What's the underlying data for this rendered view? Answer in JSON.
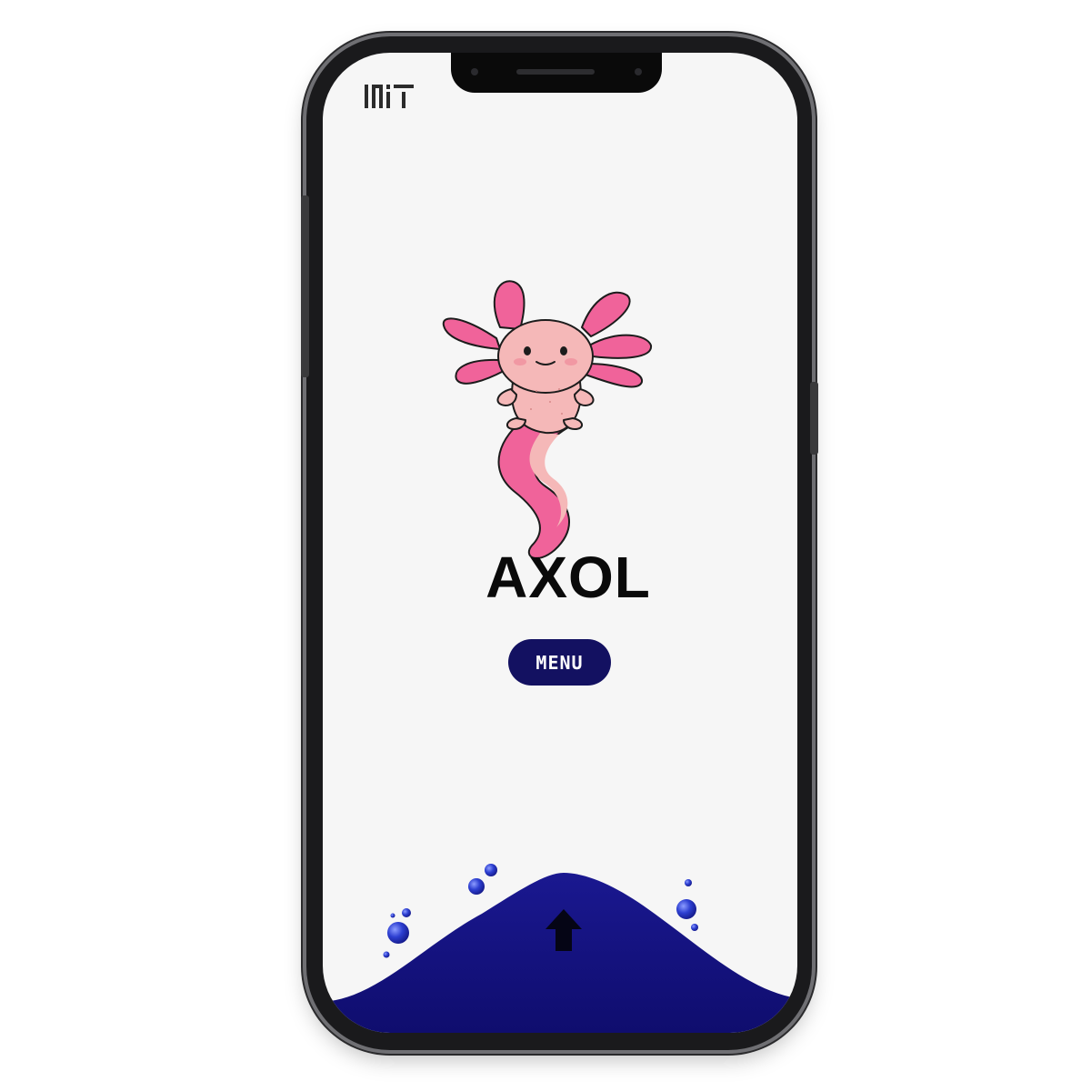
{
  "app": {
    "logo": "MIT",
    "title": "AXOL",
    "menu_button": {
      "label": "MENU"
    }
  },
  "icons": {
    "logo": "mit-logo-icon",
    "mascot": "axolotl-illustration",
    "scroll": "arrow-up-icon"
  },
  "colors": {
    "screen_background": "#f6f6f6",
    "menu_button": "#131161",
    "wave": "#12107a",
    "axolotl_gills": "#f0639a",
    "axolotl_body": "#f5b8b8"
  }
}
